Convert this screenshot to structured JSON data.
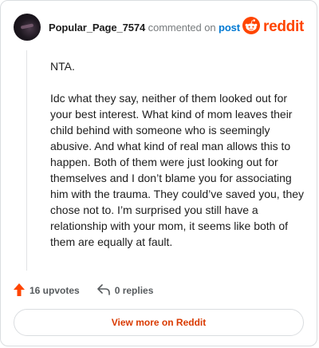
{
  "comment": {
    "author": "Popular_Page_7574",
    "action_text": "commented on",
    "post_link": "post",
    "paragraphs": [
      "NTA.",
      "Idc what they say, neither of them looked out for your best interest. What kind of mom leaves their child behind with someone who is seemingly abusive. And what kind of real man allows this to happen. Both of them were just looking out for themselves and I don’t blame you for associating him with the trauma. They could’ve saved you, they chose not to. I’m surprised you still have a relationship with your mom, it seems like both of them are equally at fault."
    ]
  },
  "brand": {
    "wordmark": "reddit",
    "icon": "reddit-snoo-icon",
    "color": "#ff4500"
  },
  "actions": {
    "upvotes_label": "16 upvotes",
    "upvote_icon": "upvote-arrow-icon",
    "upvote_color": "#ff4500",
    "replies_label": "0 replies",
    "reply_icon": "reply-arrow-icon"
  },
  "footer": {
    "view_more_label": "View more on Reddit",
    "color": "#d93a00"
  }
}
